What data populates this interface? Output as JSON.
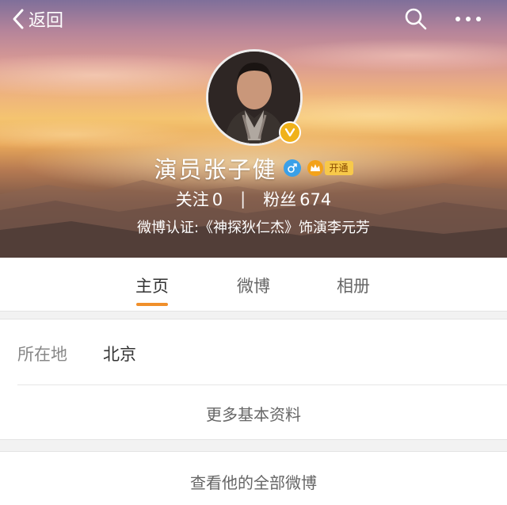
{
  "nav": {
    "back_label": "返回",
    "search_icon": "search-icon",
    "more_icon": "more-icon"
  },
  "profile": {
    "name": "演员张子健",
    "gender_icon": "male-icon",
    "vip_badge_label": "开通",
    "following_label": "关注",
    "following_count": "0",
    "separator": "|",
    "followers_label": "粉丝",
    "followers_count": "674",
    "verification": "微博认证:《神探狄仁杰》饰演李元芳",
    "accent_color": "#f08f2b",
    "verified_color": "#f0b21a"
  },
  "tabs": [
    {
      "label": "主页",
      "active": true
    },
    {
      "label": "微博",
      "active": false
    },
    {
      "label": "相册",
      "active": false
    }
  ],
  "info": {
    "location_label": "所在地",
    "location_value": "北京",
    "more_info_label": "更多基本资料"
  },
  "footer": {
    "view_all_label": "查看他的全部微博"
  }
}
